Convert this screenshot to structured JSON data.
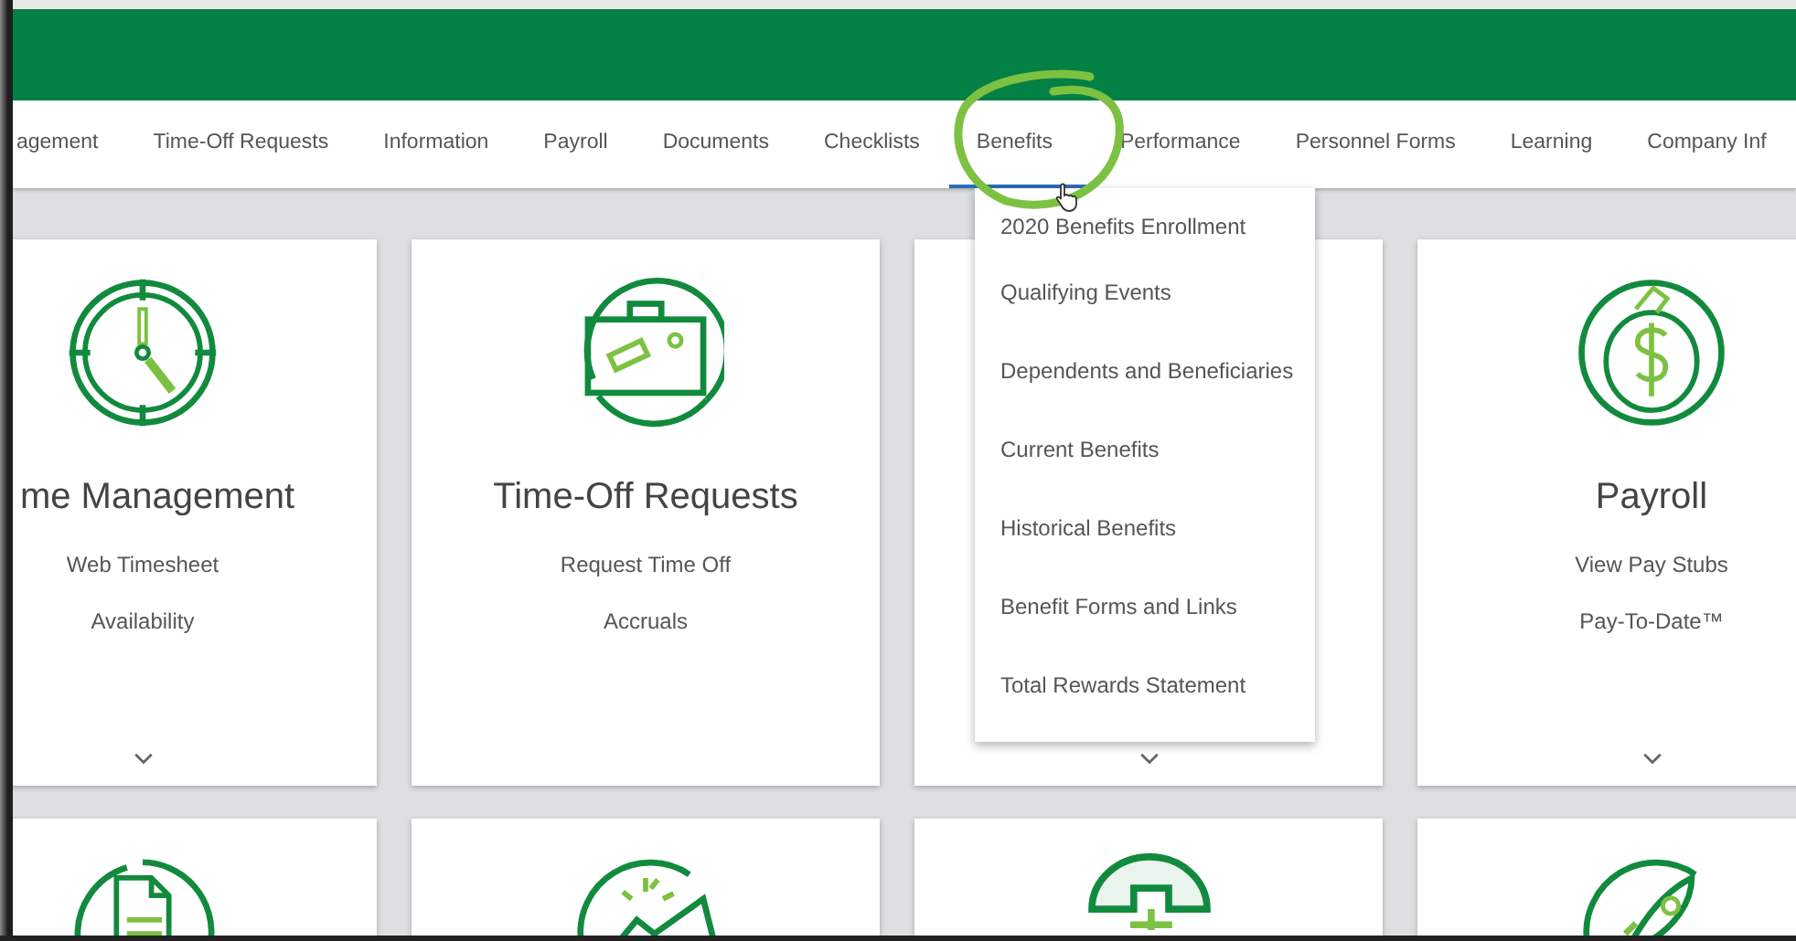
{
  "nav": [
    {
      "label": "agement",
      "selected": false
    },
    {
      "label": "Time-Off Requests",
      "selected": false
    },
    {
      "label": "Information",
      "selected": false
    },
    {
      "label": "Payroll",
      "selected": false
    },
    {
      "label": "Documents",
      "selected": false
    },
    {
      "label": "Checklists",
      "selected": false
    },
    {
      "label": "Benefits",
      "selected": true
    },
    {
      "label": "Performance",
      "selected": false
    },
    {
      "label": "Personnel Forms",
      "selected": false
    },
    {
      "label": "Learning",
      "selected": false
    },
    {
      "label": "Company Inf",
      "selected": false
    }
  ],
  "dropdown": {
    "items": [
      "2020 Benefits Enrollment",
      "Qualifying Events",
      "Dependents and Beneficiaries",
      "Current Benefits",
      "Historical Benefits",
      "Benefit Forms and Links",
      "Total Rewards Statement"
    ]
  },
  "cards": [
    {
      "title": "me Management",
      "links": [
        "Web Timesheet",
        "Availability"
      ],
      "expandable": true
    },
    {
      "title": "Time-Off Requests",
      "links": [
        "Request Time Off",
        "Accruals"
      ],
      "expandable": false
    },
    {
      "expandable": true
    },
    {
      "title": "Payroll",
      "links": [
        "View Pay Stubs",
        "Pay-To-Date™"
      ],
      "expandable": true
    }
  ]
}
